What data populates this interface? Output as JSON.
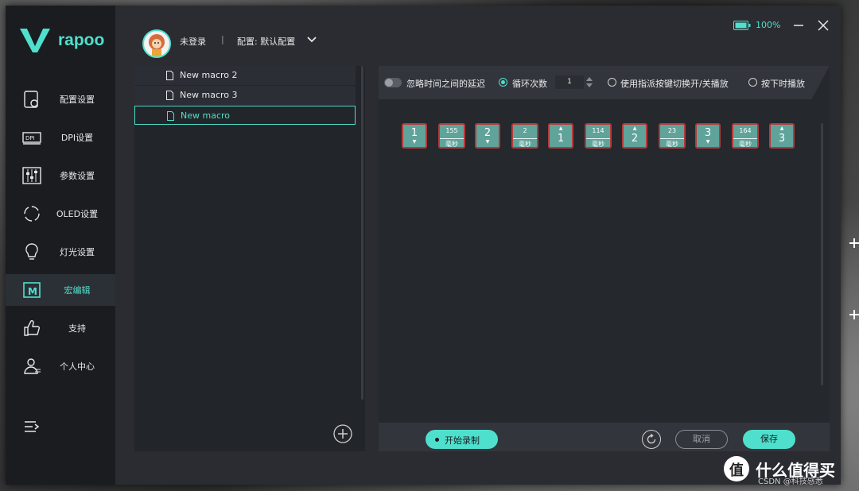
{
  "brand": {
    "name": "rapoo",
    "accent": "#4fe0cd"
  },
  "sidebar": {
    "items": [
      {
        "label": "配置设置",
        "icon": "config-settings-icon"
      },
      {
        "label": "DPI设置",
        "icon": "dpi-icon",
        "icon_text": "DPI"
      },
      {
        "label": "参数设置",
        "icon": "sliders-icon"
      },
      {
        "label": "OLED设置",
        "icon": "oled-icon"
      },
      {
        "label": "灯光设置",
        "icon": "lightbulb-icon"
      },
      {
        "label": "宏编辑",
        "icon": "macro-icon",
        "active": true
      },
      {
        "label": "支持",
        "icon": "thumbs-up-icon"
      },
      {
        "label": "个人中心",
        "icon": "user-profile-icon"
      }
    ]
  },
  "header": {
    "user_status": "未登录",
    "separator": "|",
    "profile": "配置: 默认配置",
    "battery": "100%"
  },
  "macro_list": {
    "items": [
      {
        "name": "New macro 2",
        "selected": false
      },
      {
        "name": "New macro 3",
        "selected": false
      },
      {
        "name": "New macro",
        "selected": true
      }
    ]
  },
  "editor": {
    "toolbar": {
      "ignore_delay_label": "忽略时间之间的延迟",
      "loop_label": "循环次数",
      "loop_count": "1",
      "toggle_label": "使用指派按键切换开/关播放",
      "hold_label": "按下时播放",
      "selected_mode": "loop"
    },
    "sequence": [
      {
        "type": "key",
        "key": "1",
        "action": "down"
      },
      {
        "type": "delay",
        "value": "155",
        "unit": "毫秒"
      },
      {
        "type": "key",
        "key": "2",
        "action": "down"
      },
      {
        "type": "delay",
        "value": "2",
        "unit": "毫秒"
      },
      {
        "type": "key",
        "key": "1",
        "action": "up"
      },
      {
        "type": "delay",
        "value": "114",
        "unit": "毫秒"
      },
      {
        "type": "key",
        "key": "2",
        "action": "up"
      },
      {
        "type": "delay",
        "value": "23",
        "unit": "毫秒"
      },
      {
        "type": "key",
        "key": "3",
        "action": "down"
      },
      {
        "type": "delay",
        "value": "164",
        "unit": "毫秒"
      },
      {
        "type": "key",
        "key": "3",
        "action": "up"
      }
    ],
    "footer": {
      "record_label": "开始录制",
      "cancel_label": "取消",
      "save_label": "保存"
    }
  },
  "watermark": {
    "site": "什么值得买",
    "logo_text": "值",
    "credit": "CSDN @科技感悉"
  }
}
